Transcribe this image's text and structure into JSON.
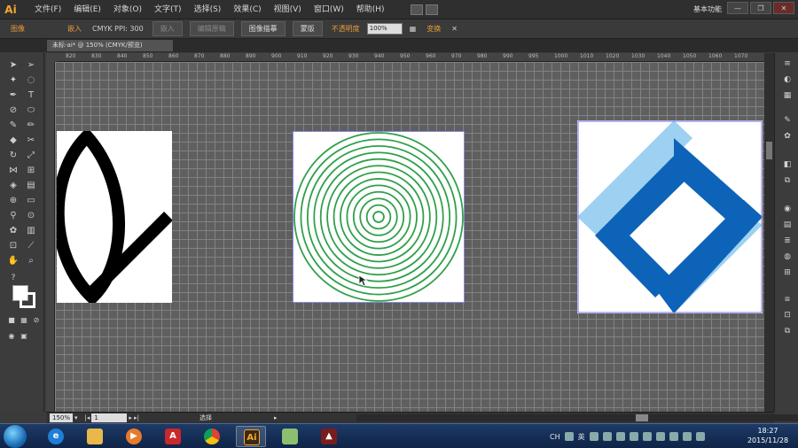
{
  "app": {
    "logo": "Ai",
    "workspace": "基本功能"
  },
  "menu": [
    "文件(F)",
    "编辑(E)",
    "对象(O)",
    "文字(T)",
    "选择(S)",
    "效果(C)",
    "视图(V)",
    "窗口(W)",
    "帮助(H)"
  ],
  "window_controls": {
    "minimize": "—",
    "restore": "❐",
    "close": "✕"
  },
  "controlbar": {
    "object_type": "图像",
    "embed_label": "嵌入",
    "color_info": "CMYK  PPI: 300",
    "embed_button": "嵌入",
    "edit_original": "编辑原稿",
    "image_trace": "图像描摹",
    "mask": "蒙版",
    "opacity_label": "不透明度",
    "opacity_value": "100%",
    "transform": "变换"
  },
  "document": {
    "tab_title": "未标-ai* @ 150% (CMYK/预览)"
  },
  "ruler": {
    "marks": [
      "820",
      "830",
      "840",
      "850",
      "860",
      "870",
      "880",
      "890",
      "900",
      "910",
      "920",
      "930",
      "940",
      "950",
      "960",
      "970",
      "980",
      "990",
      "995",
      "1000",
      "1010",
      "1020",
      "1030",
      "1040",
      "1050",
      "1060",
      "1070"
    ]
  },
  "statusbar": {
    "zoom": "150%",
    "page": "1",
    "tool_label": "选择"
  },
  "taskbar": {
    "apps": [
      "ie",
      "explorer",
      "media",
      "acrobat",
      "chrome",
      "illustrator",
      "folder",
      "unknown"
    ],
    "tray": {
      "lang": "CH",
      "ime": "英"
    },
    "time": "18:27",
    "date": "2015/11/28"
  },
  "colors": {
    "accent": "#f7a531",
    "green_rings": "#2fa04a",
    "blue_dark": "#0d63b8",
    "blue_light": "#9ed0f2"
  }
}
